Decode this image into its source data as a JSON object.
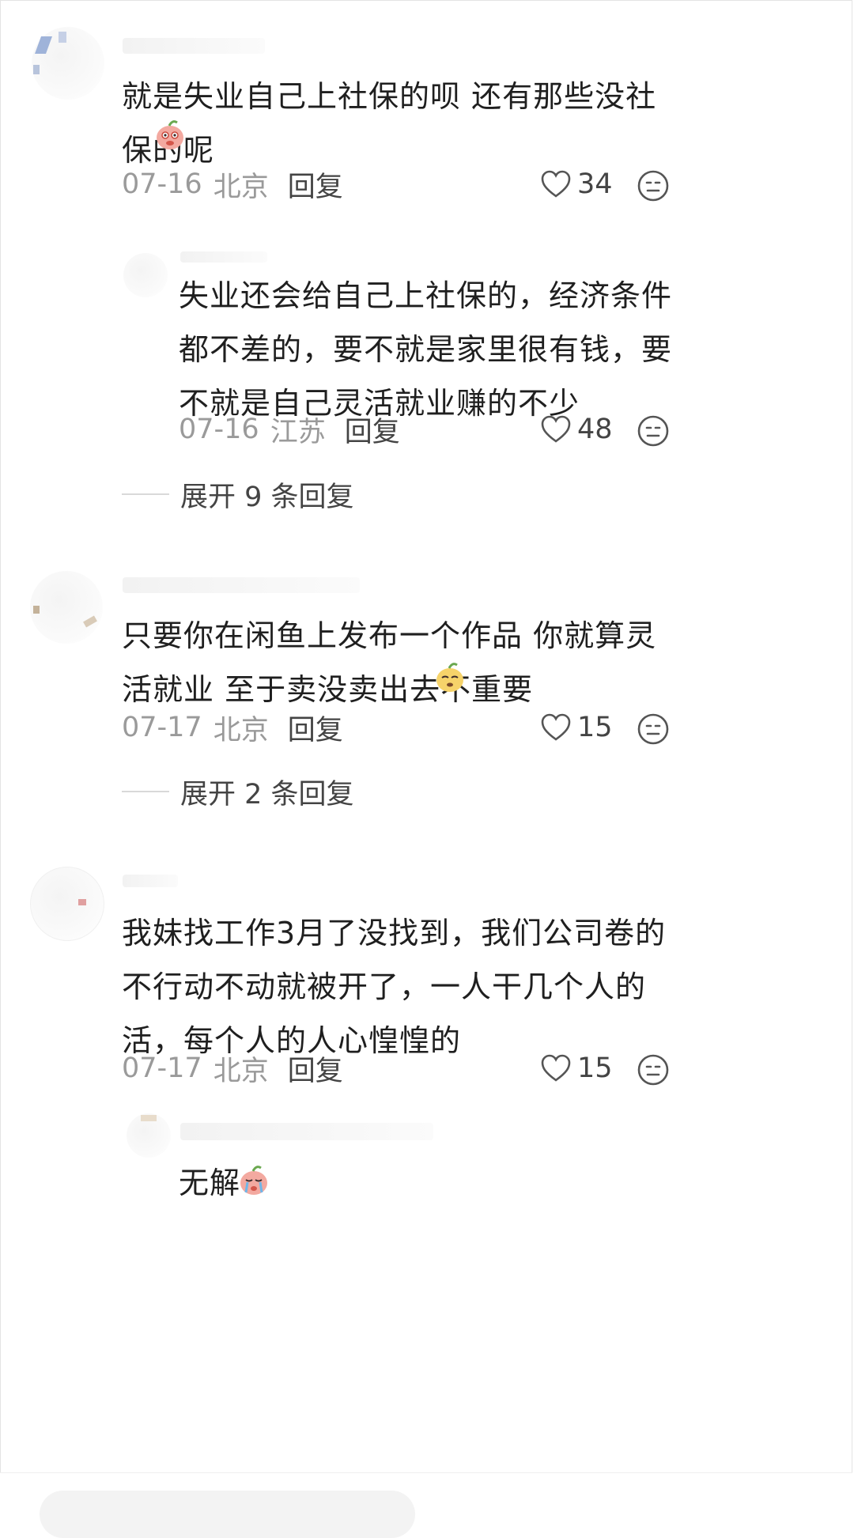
{
  "comments": [
    {
      "text": "就是失业自己上社保的呗 还有那些没社保的呢",
      "date": "07-16",
      "location": "北京",
      "reply_label": "回复",
      "likes": "34",
      "emoji": "grimace-peach-emoji"
    },
    {
      "text": "失业还会给自己上社保的，经济条件都不差的，要不就是家里很有钱，要不就是自己灵活就业赚的不少",
      "date": "07-16",
      "location": "江苏",
      "reply_label": "回复",
      "likes": "48"
    },
    {
      "expand_label": "展开 9 条回复"
    },
    {
      "text": "只要你在闲鱼上发布一个作品 你就算灵活就业 至于卖没卖出去不重要",
      "date": "07-17",
      "location": "北京",
      "reply_label": "回复",
      "likes": "15",
      "emoji": "smirk-melon-emoji"
    },
    {
      "expand_label": "展开 2 条回复"
    },
    {
      "text": "我妹找工作3月了没找到，我们公司卷的不行动不动就被开了，一人干几个人的活，每个人的人心惶惶的",
      "date": "07-17",
      "location": "北京",
      "reply_label": "回复",
      "likes": "15"
    },
    {
      "text": "无解",
      "emoji": "crying-peach-emoji"
    }
  ],
  "colors": {
    "text": "#1f1f1f",
    "meta": "#9a9a9a",
    "action": "#444444"
  }
}
